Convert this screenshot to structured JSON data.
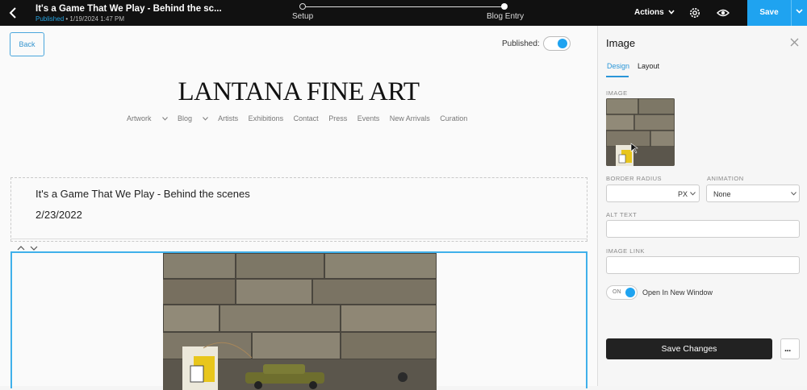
{
  "topbar": {
    "page_title": "It's a Game That We Play - Behind the sc...",
    "status": "Published",
    "timestamp": "1/19/2024 1:47 PM",
    "steps": [
      "Setup",
      "Blog Entry"
    ],
    "actions_label": "Actions",
    "save_label": "Save"
  },
  "canvas": {
    "back_label": "Back",
    "published_label": "Published:",
    "brand": "LANTANA FINE ART",
    "nav": [
      "Artwork",
      "Blog",
      "Artists",
      "Exhibitions",
      "Contact",
      "Press",
      "Events",
      "New Arrivals",
      "Curation"
    ],
    "post_title": "It's a Game That We Play - Behind the scenes",
    "post_date": "2/23/2022"
  },
  "panel": {
    "title": "Image",
    "tabs": [
      "Design",
      "Layout"
    ],
    "image_label": "IMAGE",
    "border_radius_label": "BORDER RADIUS",
    "border_radius_unit": "PX",
    "animation_label": "ANIMATION",
    "animation_value": "None",
    "alt_text_label": "ALT TEXT",
    "alt_text_value": "",
    "image_link_label": "IMAGE LINK",
    "image_link_value": "",
    "toggle_on": "ON",
    "open_new_window_label": "Open In New Window",
    "save_changes_label": "Save Changes",
    "more_label": "..."
  },
  "colors": {
    "accent": "#1fa3f0",
    "topbar": "#111111",
    "dark_button": "#222222"
  }
}
